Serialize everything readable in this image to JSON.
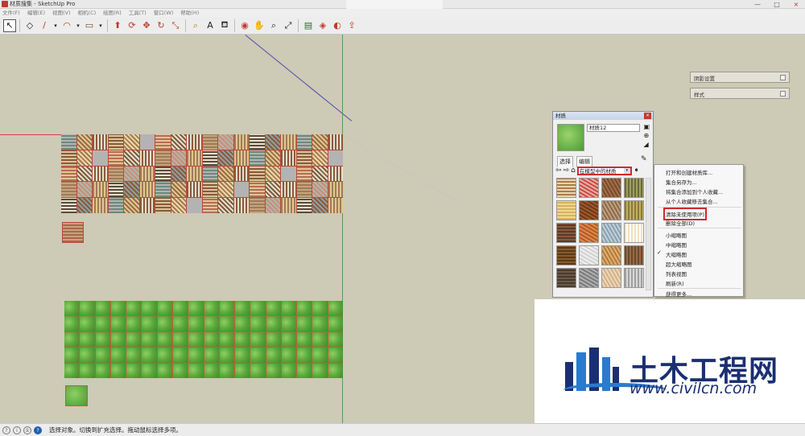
{
  "window": {
    "title": "材质搜集 - SketchUp Pro",
    "controls": [
      "—",
      "□",
      "×"
    ]
  },
  "menu": [
    "文件(F)",
    "编辑(E)",
    "视图(V)",
    "相机(C)",
    "绘图(R)",
    "工具(T)",
    "窗口(W)",
    "帮助(H)"
  ],
  "toolbar": {
    "icons": [
      "select-icon",
      "eraser-icon",
      "pencil-icon",
      "dropdown-icon",
      "arc-icon",
      "dropdown-icon",
      "rectangle-icon",
      "dropdown-icon",
      "push-pull-icon",
      "follow-me-icon",
      "move-icon",
      "rotate-icon",
      "scale-icon",
      "tape-measure-icon",
      "text-icon",
      "paint-bucket-icon",
      "orbit-icon",
      "pan-icon",
      "zoom-icon",
      "zoom-extents-icon",
      "components-icon",
      "materials-icon",
      "styles-icon",
      "export-icon"
    ],
    "glyphs": [
      "↖",
      "◇",
      "/",
      "▾",
      "◠",
      "▾",
      "▭",
      "▾",
      "⬆",
      "⟳",
      "✥",
      "↻",
      "⤡",
      "⌕",
      "A",
      "⛾",
      "◉",
      "✋",
      "⌕",
      "⤢",
      "▤",
      "◈",
      "◐",
      "⇪"
    ]
  },
  "colors": {
    "menu_highlight": "#d12a2a",
    "logo_blue": "#1a2f72",
    "logo_swoosh": "#2a7ad0",
    "grass": "#5aa83a"
  },
  "side_panels": [
    {
      "label": "阴影设置"
    },
    {
      "label": "样式"
    }
  ],
  "materials_panel": {
    "title": "材质",
    "current_name": "材质12",
    "tabs": [
      "选择",
      "编辑"
    ],
    "collection": "在模型中的材质",
    "close": "×"
  },
  "context_menu": {
    "group1": [
      "打开和创建材质库...",
      "集合另存为...",
      "将集合添加到个人收藏...",
      "从个人收藏移去集合..."
    ],
    "highlight": "清除未使用项(P)",
    "delete_all": "删除全部(D)",
    "group3": [
      "小缩略图",
      "中缩略图",
      "大缩略图",
      "超大缩略图",
      "列表视图",
      "刷新(R)"
    ],
    "checked_item": "✓",
    "more": "获得更多..."
  },
  "logo": {
    "name_cn": "土木工程网",
    "url": "www.civilcn.com"
  },
  "statusbar": {
    "icons": [
      "?",
      "i",
      "①"
    ],
    "text": "选择对象。切换到扩充选择。拖动鼠标选择多项。"
  }
}
